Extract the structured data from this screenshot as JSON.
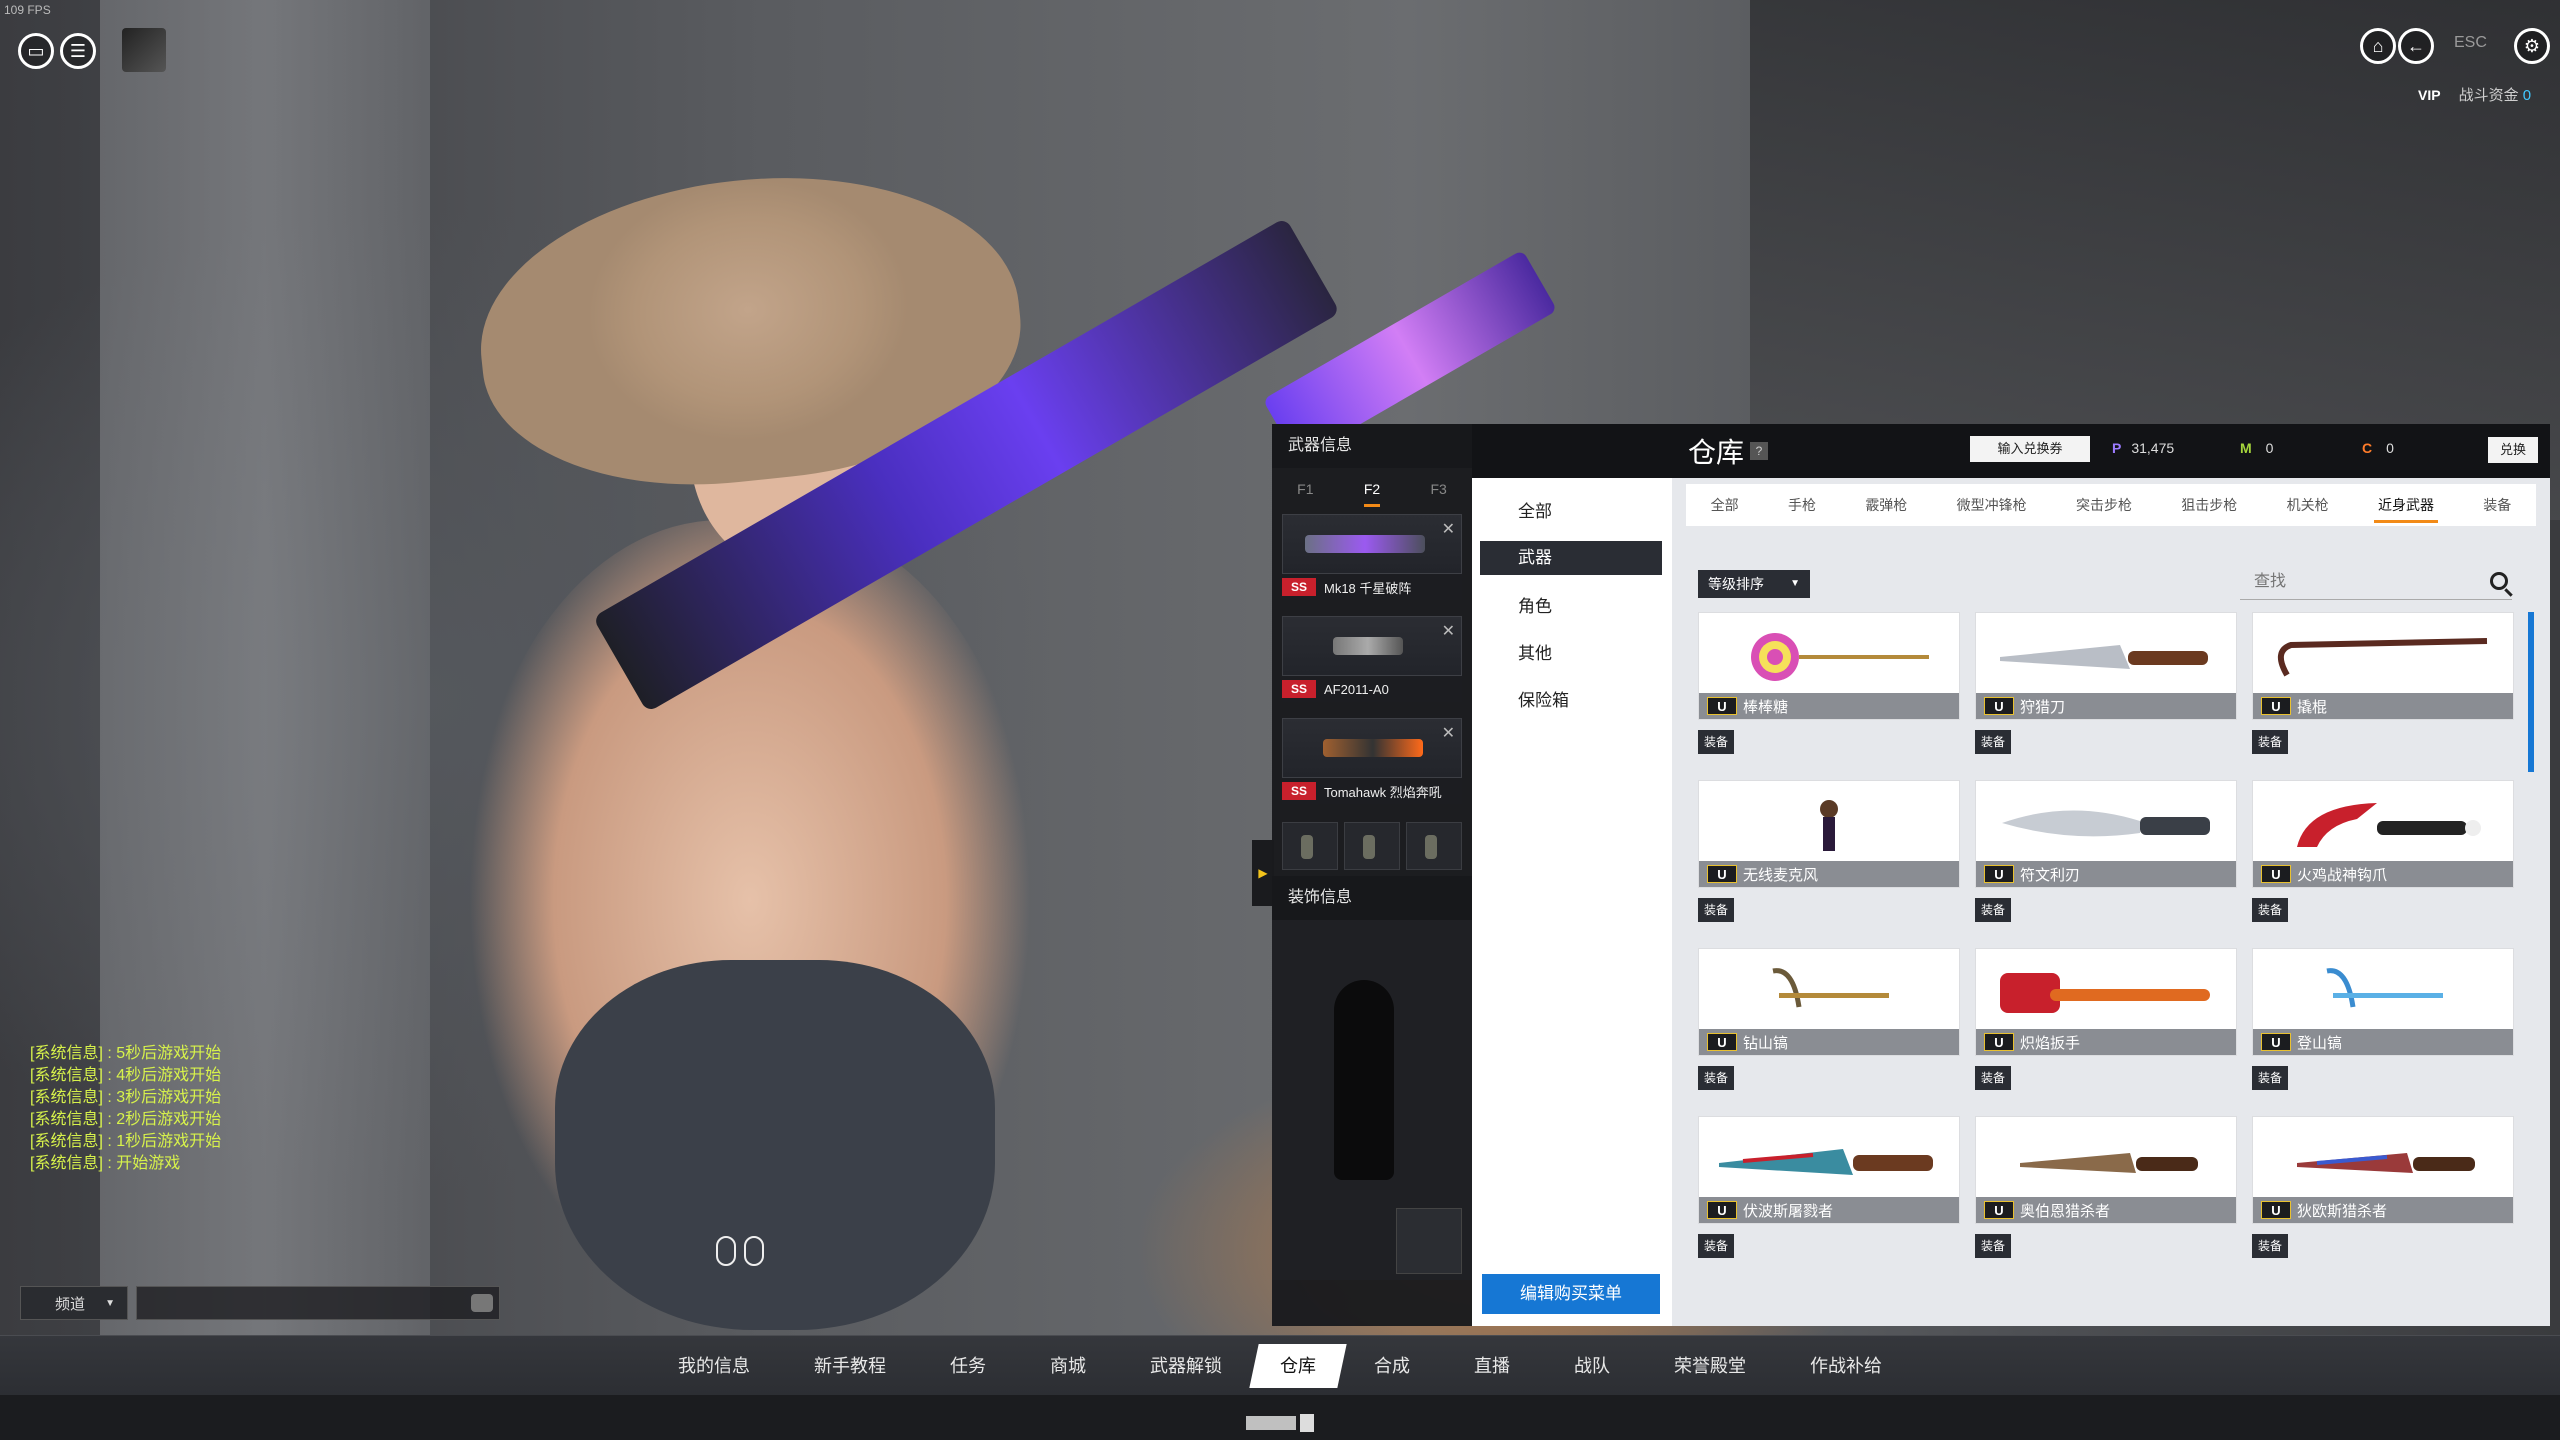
{
  "hud": {
    "fps": "109 FPS",
    "esc": "ESC",
    "vip": "VIP",
    "fund_label": "战斗资金",
    "fund_value": "0"
  },
  "chat": {
    "messages": [
      "[系统信息] : 5秒后游戏开始",
      "[系统信息] : 4秒后游戏开始",
      "[系统信息] : 3秒后游戏开始",
      "[系统信息] : 2秒后游戏开始",
      "[系统信息] : 1秒后游戏开始",
      "[系统信息] : 开始游戏"
    ],
    "channel": "频道",
    "input_value": ""
  },
  "weapon_info": {
    "title": "武器信息",
    "tabs": [
      "F1",
      "F2",
      "F3"
    ],
    "active_tab": "F2",
    "slots": [
      {
        "badge": "SS",
        "name": "Mk18 千星破阵"
      },
      {
        "badge": "SS",
        "name": "AF2011-A0"
      },
      {
        "badge": "SS",
        "name": "Tomahawk 烈焰奔吼"
      }
    ],
    "decor_title": "装饰信息"
  },
  "warehouse": {
    "title": "仓库",
    "help": "?",
    "redeem_button": "输入兑换券",
    "currency": {
      "p_label": "P",
      "p_value": "31,475",
      "m_label": "M",
      "m_value": "0",
      "c_label": "C",
      "c_value": "0"
    },
    "exchange_button": "兑换",
    "categories": [
      "全部",
      "武器",
      "角色",
      "其他",
      "保险箱"
    ],
    "active_category": "武器",
    "edit_menu_button": "编辑购买菜单",
    "subtabs": [
      "全部",
      "手枪",
      "霰弹枪",
      "微型冲锋枪",
      "突击步枪",
      "狙击步枪",
      "机关枪",
      "近身武器",
      "装备"
    ],
    "active_subtab": "近身武器",
    "sort_label": "等级排序",
    "search_placeholder": "查找",
    "equip_label": "装备",
    "items": [
      {
        "badge": "U",
        "name": "棒棒糖"
      },
      {
        "badge": "U",
        "name": "狩猎刀"
      },
      {
        "badge": "U",
        "name": "撬棍"
      },
      {
        "badge": "U",
        "name": "无线麦克风"
      },
      {
        "badge": "U",
        "name": "符文利刃"
      },
      {
        "badge": "U",
        "name": "火鸡战神钩爪"
      },
      {
        "badge": "U",
        "name": "钻山镐"
      },
      {
        "badge": "U",
        "name": "炽焰扳手"
      },
      {
        "badge": "U",
        "name": "登山镐"
      },
      {
        "badge": "U",
        "name": "伏波斯屠戮者"
      },
      {
        "badge": "U",
        "name": "奥伯恩猎杀者"
      },
      {
        "badge": "U",
        "name": "狄欧斯猎杀者"
      }
    ]
  },
  "bottom_nav": {
    "items": [
      "我的信息",
      "新手教程",
      "任务",
      "商城",
      "武器解锁",
      "仓库",
      "合成",
      "直播",
      "战队",
      "荣誉殿堂",
      "作战补给"
    ],
    "active": "仓库"
  },
  "colors": {
    "accent_orange": "#f28a17",
    "primary_blue": "#1677d4",
    "ss_red": "#c8202c",
    "chat_yellow": "#d7f24b"
  }
}
